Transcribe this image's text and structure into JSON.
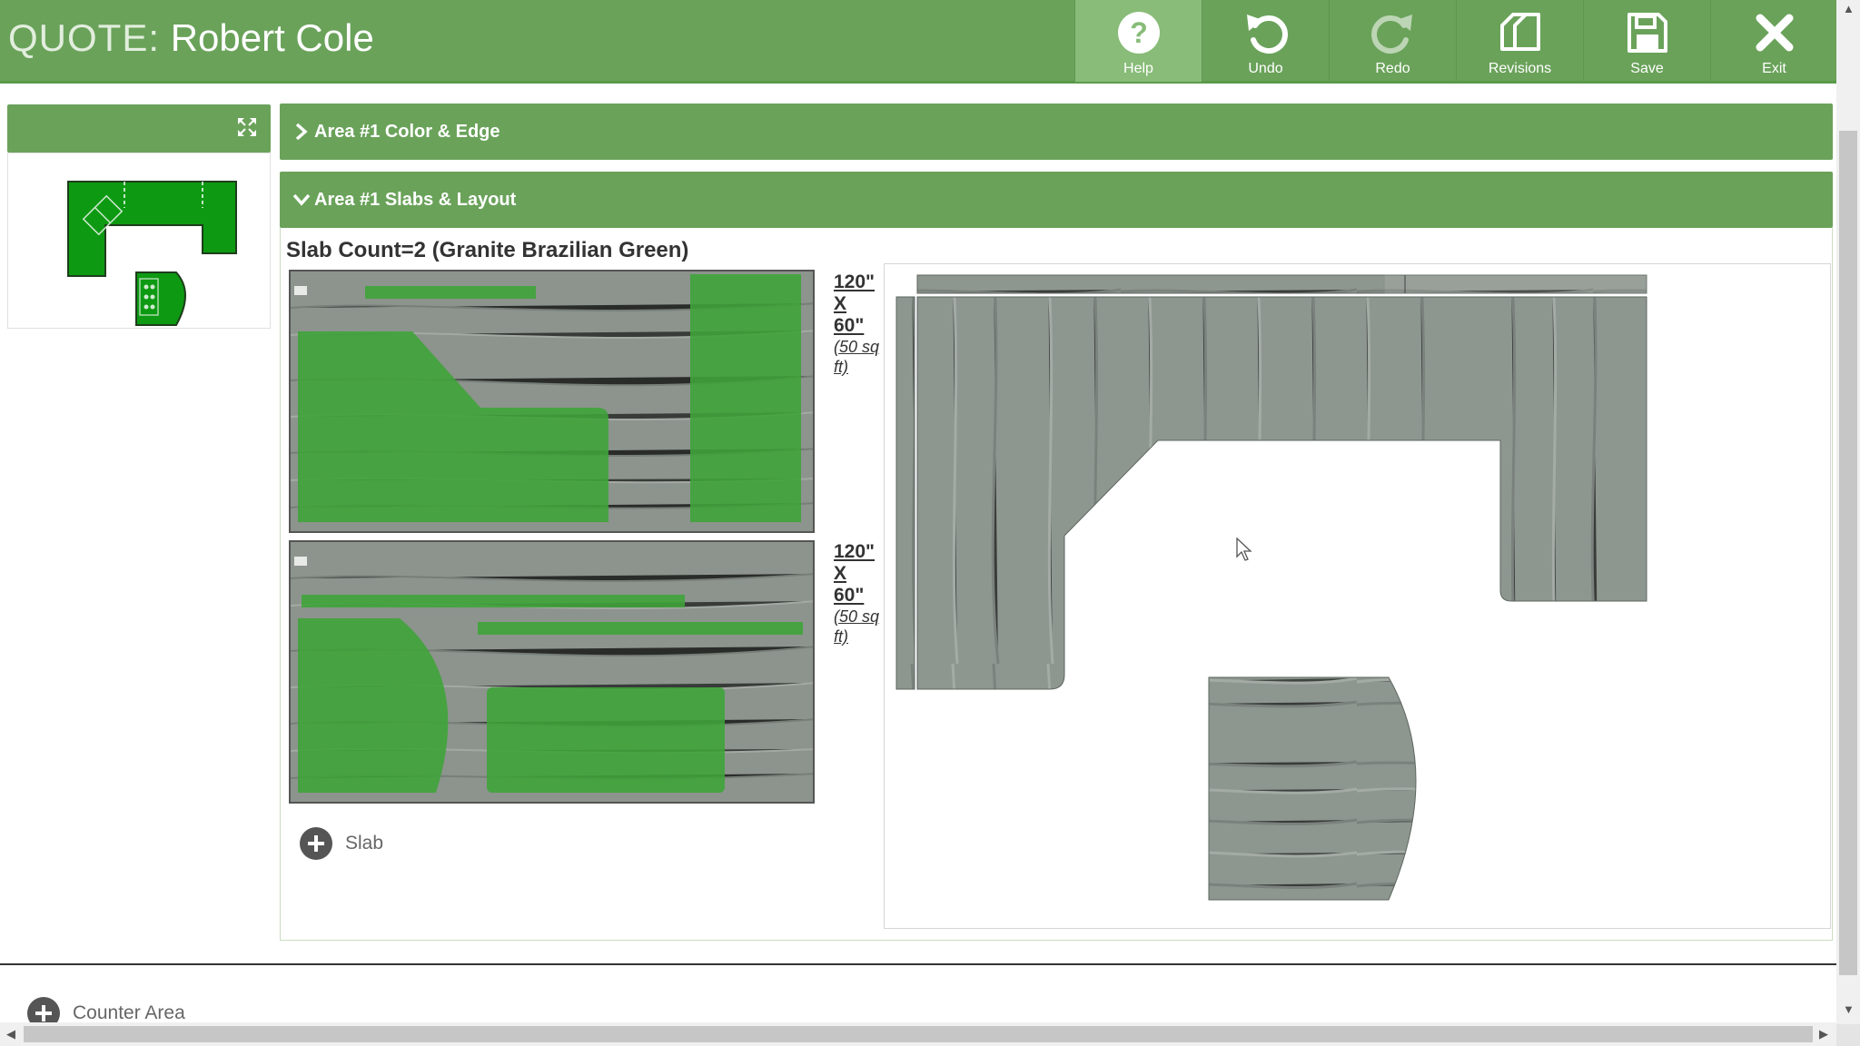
{
  "header": {
    "prefix": "QUOTE:",
    "customer": "Robert Cole",
    "bar_color": "#6aa25a"
  },
  "toolbar": [
    {
      "label": "Help",
      "icon": "help-icon",
      "active": true
    },
    {
      "label": "Undo",
      "icon": "undo-icon",
      "active": false
    },
    {
      "label": "Redo",
      "icon": "redo-icon",
      "active": false
    },
    {
      "label": "Revisions",
      "icon": "revisions-icon",
      "active": false
    },
    {
      "label": "Save",
      "icon": "save-icon",
      "active": false
    },
    {
      "label": "Exit",
      "icon": "exit-icon",
      "active": false
    }
  ],
  "sections": {
    "color_edge": {
      "title": "Area #1 Color & Edge",
      "expanded": false
    },
    "slabs_layout": {
      "title": "Area #1 Slabs & Layout",
      "expanded": true
    }
  },
  "slab_summary": "Slab Count=2 (Granite Brazilian Green)",
  "slabs": [
    {
      "w": "120\"",
      "x": "X",
      "h": "60\"",
      "area": "(50 sq ft)"
    },
    {
      "w": "120\"",
      "x": "X",
      "h": "60\"",
      "area": "(50 sq ft)"
    }
  ],
  "add_slab_label": "Slab",
  "add_area_label": "Counter Area",
  "colors": {
    "piece_green": "#3fa33a",
    "stone_gray": "#8e9690",
    "accent": "#6aa25a"
  }
}
